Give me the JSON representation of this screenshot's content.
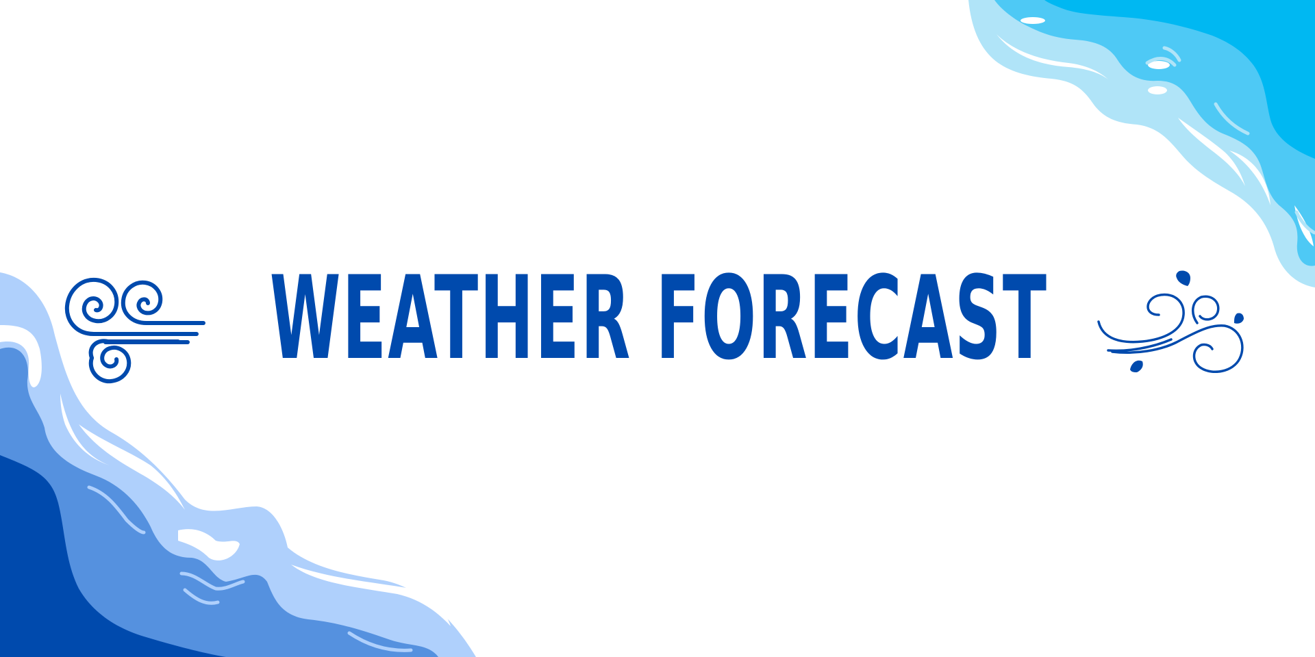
{
  "title": "WEATHER FORECAST",
  "colors": {
    "background": "#ffffff",
    "title": "#004aad",
    "icon_stroke": "#004aad",
    "wave_dark_blue": "#004aad",
    "wave_mid_blue": "#5591df",
    "wave_light_blue": "#afd0fc",
    "wave_cyan": "#00b8f2",
    "wave_sky": "#4ec9f5",
    "wave_pale_sky": "#b0e4f8",
    "foam": "#ffffff"
  },
  "icons": {
    "left": "wind-swirl-icon",
    "right": "wind-gust-with-leaves-icon"
  }
}
